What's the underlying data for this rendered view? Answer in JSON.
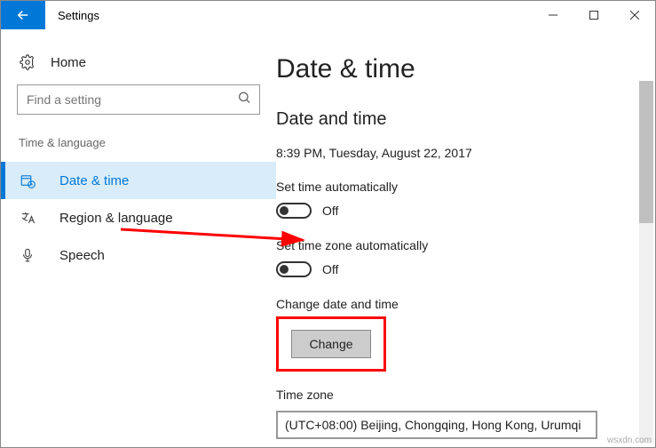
{
  "window": {
    "title": "Settings"
  },
  "sidebar": {
    "home_label": "Home",
    "search_placeholder": "Find a setting",
    "category": "Time & language",
    "items": [
      {
        "label": "Date & time"
      },
      {
        "label": "Region & language"
      },
      {
        "label": "Speech"
      }
    ]
  },
  "main": {
    "page_title": "Date & time",
    "section_heading": "Date and time",
    "current_datetime": "8:39 PM, Tuesday, August 22, 2017",
    "set_time_auto_label": "Set time automatically",
    "set_time_auto_state": "Off",
    "set_tz_auto_label": "Set time zone automatically",
    "set_tz_auto_state": "Off",
    "change_label": "Change date and time",
    "change_button": "Change",
    "timezone_label": "Time zone",
    "timezone_value": "(UTC+08:00) Beijing, Chongqing, Hong Kong, Urumqi"
  },
  "watermark": "wsxdn.com"
}
